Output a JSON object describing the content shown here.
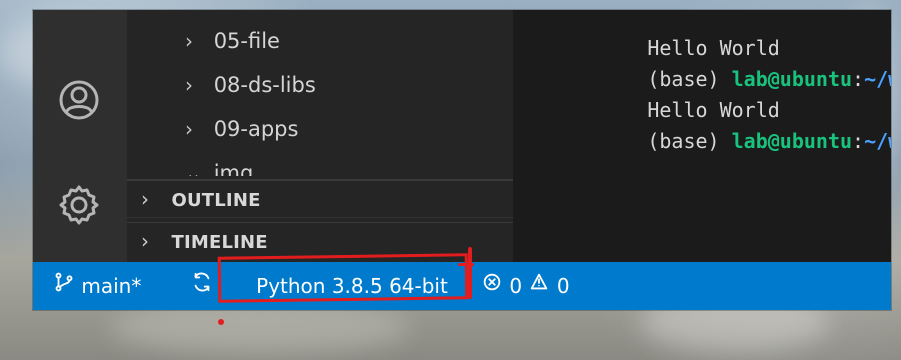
{
  "explorer": {
    "items": [
      {
        "label": "05-file",
        "icon": "chevron-right-icon"
      },
      {
        "label": "08-ds-libs",
        "icon": "chevron-right-icon"
      },
      {
        "label": "09-apps",
        "icon": "chevron-right-icon"
      },
      {
        "label": "img",
        "icon": "chevron-down-icon"
      }
    ],
    "outline_label": "OUTLINE",
    "timeline_label": "TIMELINE"
  },
  "activity_bar": {
    "icons": [
      {
        "name": "account-icon"
      },
      {
        "name": "settings-icon"
      }
    ]
  },
  "terminal": {
    "lines": [
      {
        "text": "Hello World"
      },
      {
        "prefix": "(base) ",
        "user": "lab@ubuntu",
        "separator": ":",
        "path": "~/wo"
      },
      {
        "text": "Hello World"
      },
      {
        "prefix": "(base) ",
        "user": "lab@ubuntu",
        "separator": ":",
        "path": "~/wo"
      }
    ]
  },
  "status_bar": {
    "branch": "main*",
    "branch_icon": "source-control-icon",
    "sync_icon": "sync-icon",
    "python_label": "Python 3.8.5 64-bit",
    "errors_icon": "error-icon",
    "errors": "0",
    "warnings_icon": "warning-icon",
    "warnings": "0"
  },
  "colors": {
    "status_bar": "#007acc",
    "annotation": "#e31d1d",
    "prompt_user": "#19c37d",
    "prompt_path": "#4aa3ff"
  }
}
